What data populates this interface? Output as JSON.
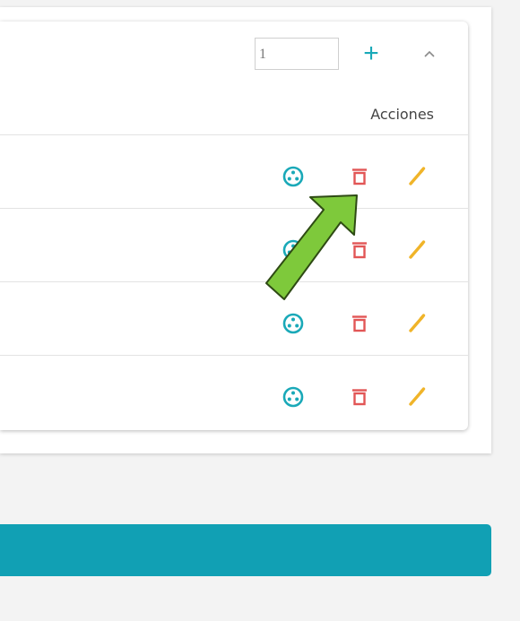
{
  "colors": {
    "teal": "#1aa9b8",
    "delete_red": "#e25656",
    "edit_yellow": "#f0b429",
    "primary_bar": "#11a0b4",
    "arrow_fill": "#7ec93b",
    "arrow_stroke": "#2e4a14"
  },
  "toolbar": {
    "quantity_value": "1",
    "add_icon": "plus-icon",
    "collapse_icon": "chevron-up-icon"
  },
  "table": {
    "actions_header": "Acciones",
    "rows": [
      {
        "actions": [
          "view-icon",
          "trash-icon",
          "pencil-icon"
        ]
      },
      {
        "actions": [
          "view-icon",
          "trash-icon",
          "pencil-icon"
        ]
      },
      {
        "actions": [
          "view-icon",
          "trash-icon",
          "pencil-icon"
        ]
      },
      {
        "actions": [
          "view-icon",
          "trash-icon",
          "pencil-icon"
        ]
      }
    ]
  },
  "primary_button": {
    "label": ""
  },
  "annotation": {
    "icon": "pointer-arrow-icon"
  }
}
